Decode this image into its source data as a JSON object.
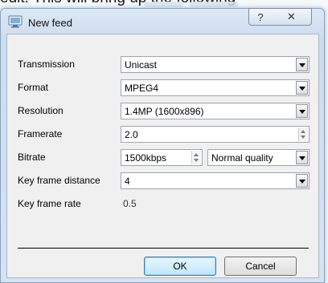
{
  "background": {
    "text": "edit. This will bring up the following"
  },
  "window": {
    "title": "New feed",
    "help_glyph": "?",
    "close_glyph": "✕"
  },
  "form": {
    "transmission": {
      "label": "Transmission",
      "value": "Unicast"
    },
    "format": {
      "label": "Format",
      "value": "MPEG4"
    },
    "resolution": {
      "label": "Resolution",
      "value": "1.4MP (1600x896)"
    },
    "framerate": {
      "label": "Framerate",
      "value": "2.0"
    },
    "bitrate": {
      "label": "Bitrate",
      "value": "1500kbps",
      "quality": "Normal quality"
    },
    "key_frame_distance": {
      "label": "Key frame distance",
      "value": "4"
    },
    "key_frame_rate": {
      "label": "Key frame rate",
      "value": "0.5"
    }
  },
  "buttons": {
    "ok": "OK",
    "cancel": "Cancel"
  },
  "colors": {
    "accent": "#3c7fb1",
    "window_frame": "#cddcee"
  }
}
